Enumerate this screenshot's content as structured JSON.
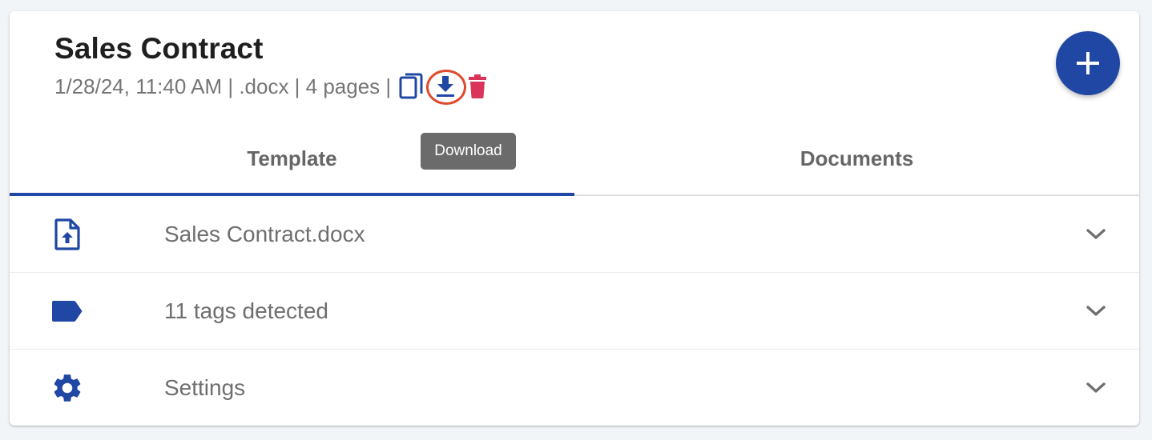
{
  "header": {
    "title": "Sales Contract",
    "meta": "1/28/24, 11:40 AM | .docx | 4 pages |",
    "icons": {
      "copy": "copy-icon",
      "download": "download-icon",
      "delete": "trash-icon"
    },
    "add_icon": "plus-icon"
  },
  "tooltip": {
    "text": "Download"
  },
  "tabs": [
    {
      "label": "Template",
      "active": true
    },
    {
      "label": "Documents",
      "active": false
    }
  ],
  "rows": [
    {
      "icon": "file-upload-icon",
      "label": "Sales Contract.docx"
    },
    {
      "icon": "tag-icon",
      "label": "11 tags detected"
    },
    {
      "icon": "gear-icon",
      "label": "Settings"
    }
  ],
  "colors": {
    "primary": "#1f47a3",
    "delete": "#d9345a",
    "highlight_ring": "#e04a2f",
    "tooltip_bg": "#6b6b6b"
  }
}
